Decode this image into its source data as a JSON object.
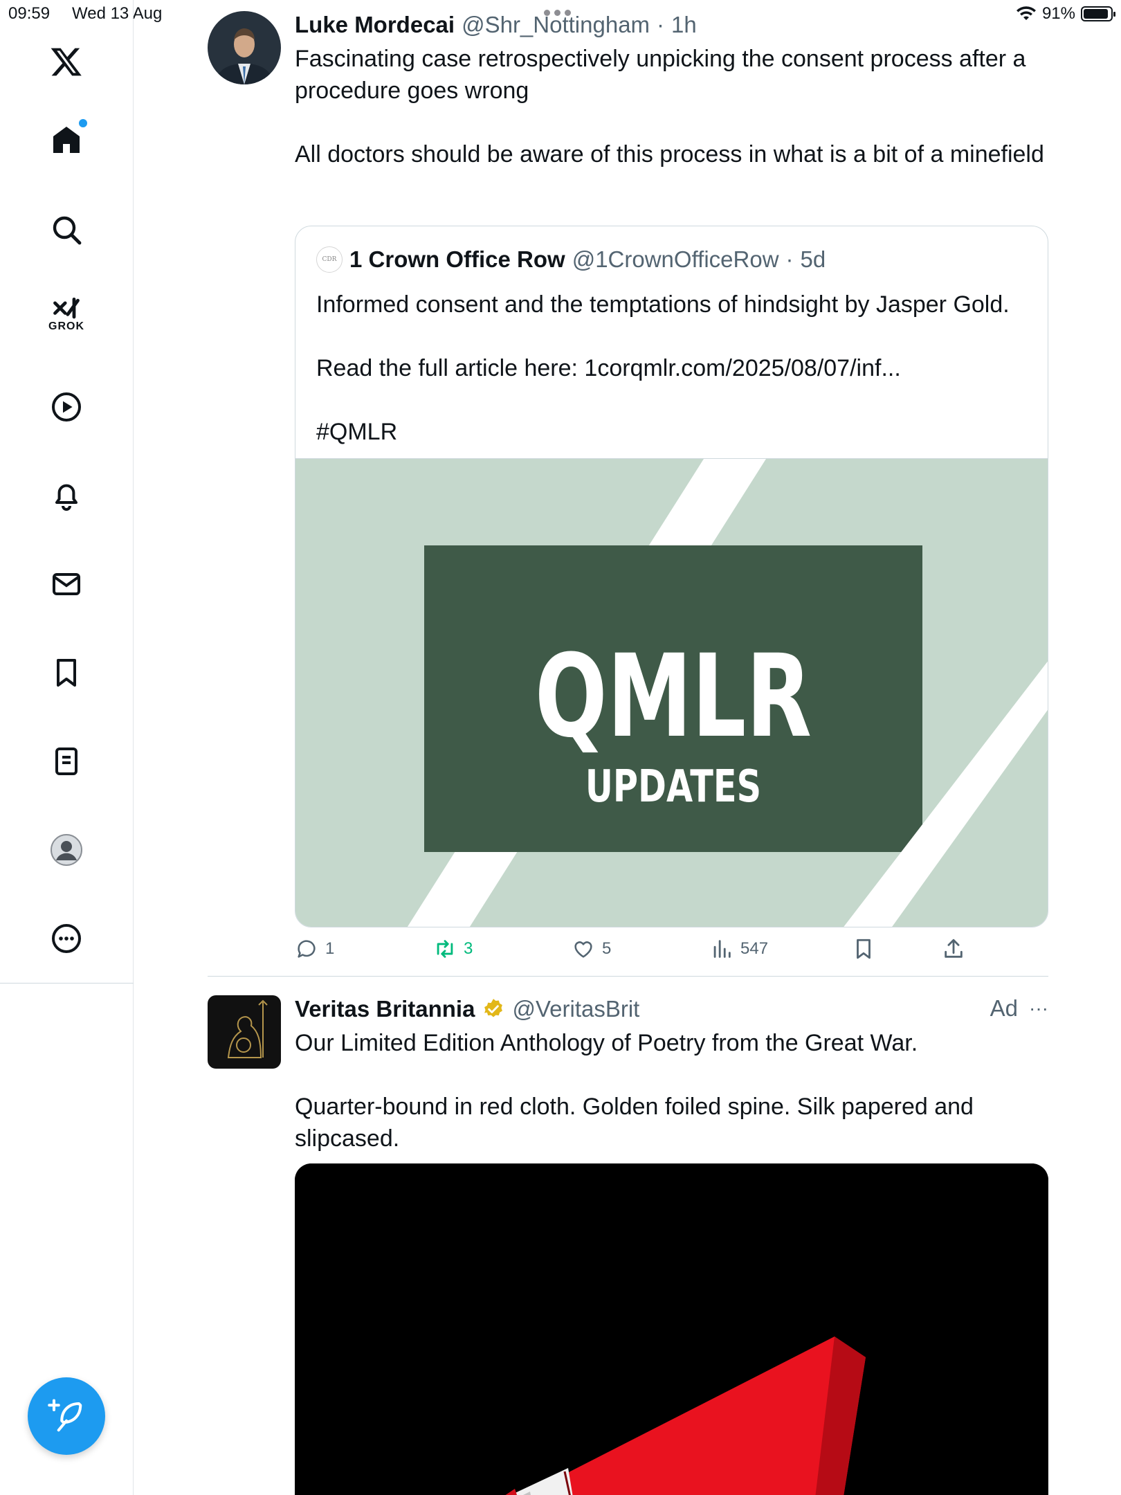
{
  "status_bar": {
    "time": "09:59",
    "date": "Wed 13 Aug",
    "battery": "91%",
    "battery_level": 0.91
  },
  "sidebar": {
    "grok_label": "GROK"
  },
  "post1": {
    "name": "Luke Mordecai",
    "handle": "@Shr_Nottingham",
    "sep": "·",
    "time": "1h",
    "text": "Fascinating case retrospectively unpicking the consent process after a procedure goes wrong\n\nAll doctors should be aware of this process in what is a bit of a minefield",
    "quote": {
      "logo_text": "CDR",
      "name": "1 Crown Office Row",
      "handle": "@1CrownOfficeRow",
      "sep": "·",
      "time": "5d",
      "text": "Informed consent and the temptations of hindsight by Jasper Gold.\n\nRead the full article here: 1corqmlr.com/2025/08/07/inf...\n\n#QMLR",
      "image_title": "QMLR",
      "image_subtitle": "UPDATES"
    },
    "actions": {
      "replies": "1",
      "reposts": "3",
      "likes": "5",
      "views": "547"
    }
  },
  "post2": {
    "name": "Veritas Britannia",
    "handle": "@VeritasBrit",
    "ad_label": "Ad",
    "more": "···",
    "text": "Our Limited Edition Anthology of Poetry from the Great War.\n\nQuarter-bound in red cloth. Golden foiled spine. Silk papered and slipcased."
  },
  "colors": {
    "accent": "#1d9bf0",
    "repost": "#00ba7c",
    "muted": "#536471",
    "qmlr_green": "#3f5a48",
    "qmlr_bg": "#c5d8cc"
  }
}
